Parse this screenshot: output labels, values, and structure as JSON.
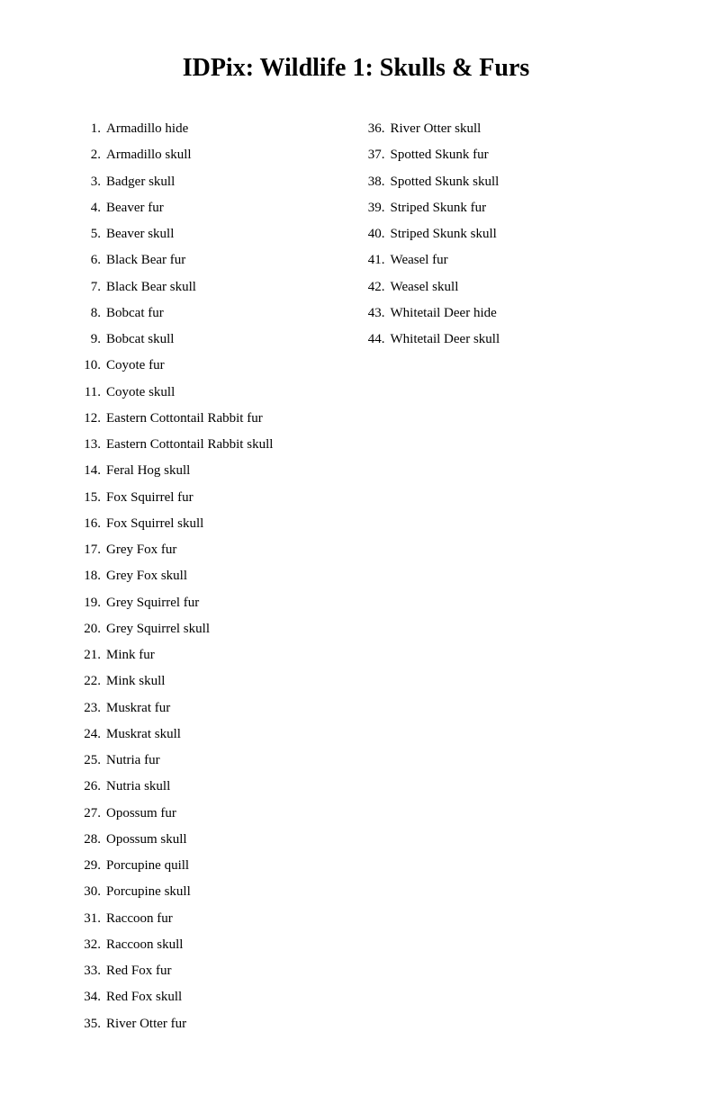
{
  "page": {
    "title": "IDPix: Wildlife 1: Skulls & Furs",
    "left_column": [
      {
        "number": "1.",
        "text": "Armadillo hide"
      },
      {
        "number": "2.",
        "text": "Armadillo skull"
      },
      {
        "number": "3.",
        "text": "Badger skull"
      },
      {
        "number": "4.",
        "text": "Beaver fur"
      },
      {
        "number": "5.",
        "text": "Beaver skull"
      },
      {
        "number": "6.",
        "text": "Black Bear fur"
      },
      {
        "number": "7.",
        "text": "Black Bear skull"
      },
      {
        "number": "8.",
        "text": "Bobcat fur"
      },
      {
        "number": "9.",
        "text": "Bobcat skull"
      },
      {
        "number": "10.",
        "text": "Coyote fur"
      },
      {
        "number": "11.",
        "text": "Coyote skull"
      },
      {
        "number": "12.",
        "text": "Eastern Cottontail Rabbit fur"
      },
      {
        "number": "13.",
        "text": "Eastern Cottontail Rabbit skull"
      },
      {
        "number": "14.",
        "text": "Feral Hog skull"
      },
      {
        "number": "15.",
        "text": "Fox Squirrel fur"
      },
      {
        "number": "16.",
        "text": "Fox Squirrel skull"
      },
      {
        "number": "17.",
        "text": "Grey Fox fur"
      },
      {
        "number": "18.",
        "text": "Grey Fox skull"
      },
      {
        "number": "19.",
        "text": "Grey Squirrel fur"
      },
      {
        "number": "20.",
        "text": "Grey Squirrel skull"
      },
      {
        "number": "21.",
        "text": "Mink fur"
      },
      {
        "number": "22.",
        "text": "Mink skull"
      },
      {
        "number": "23.",
        "text": "Muskrat fur"
      },
      {
        "number": "24.",
        "text": "Muskrat skull"
      },
      {
        "number": "25.",
        "text": "Nutria fur"
      },
      {
        "number": "26.",
        "text": "Nutria skull"
      },
      {
        "number": "27.",
        "text": "Opossum fur"
      },
      {
        "number": "28.",
        "text": "Opossum skull"
      },
      {
        "number": "29.",
        "text": "Porcupine quill"
      },
      {
        "number": "30.",
        "text": "Porcupine skull"
      },
      {
        "number": "31.",
        "text": "Raccoon fur"
      },
      {
        "number": "32.",
        "text": "Raccoon skull"
      },
      {
        "number": "33.",
        "text": "Red Fox fur"
      },
      {
        "number": "34.",
        "text": "Red Fox skull"
      },
      {
        "number": "35.",
        "text": "River Otter fur"
      }
    ],
    "right_column": [
      {
        "number": "36.",
        "text": "River Otter skull"
      },
      {
        "number": "37.",
        "text": "Spotted Skunk fur"
      },
      {
        "number": "38.",
        "text": "Spotted Skunk skull"
      },
      {
        "number": "39.",
        "text": "Striped Skunk fur"
      },
      {
        "number": "40.",
        "text": "Striped Skunk skull"
      },
      {
        "number": "41.",
        "text": "Weasel fur"
      },
      {
        "number": "42.",
        "text": "Weasel skull"
      },
      {
        "number": "43.",
        "text": "Whitetail Deer hide"
      },
      {
        "number": "44.",
        "text": "Whitetail Deer skull"
      }
    ]
  }
}
